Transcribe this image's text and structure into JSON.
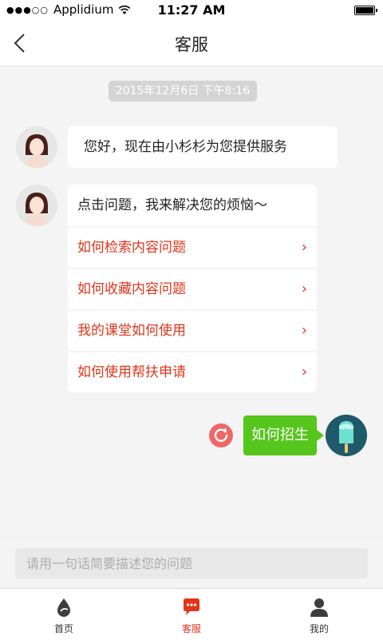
{
  "status_bar": {
    "signal": "●●●○○",
    "carrier": "Applidium",
    "time": "11:27 AM"
  },
  "nav": {
    "title": "客服"
  },
  "chat": {
    "timestamp": "2015年12月6日  下午8:16",
    "greeting": "您好，现在由小杉杉为您提供服务",
    "prompt": "点击问题，我来解决您的烦恼～",
    "questions": [
      {
        "label": "如何检索内容问题",
        "chevron": "›"
      },
      {
        "label": "如何收藏内容问题",
        "chevron": "›"
      },
      {
        "label": "我的课堂如何使用",
        "chevron": "›"
      },
      {
        "label": "如何使用帮扶申请",
        "chevron": "›"
      }
    ],
    "my_message": "如何招生"
  },
  "input": {
    "placeholder": "请用一句话简要描述您的问题",
    "value": ""
  },
  "tabs": [
    {
      "label": "首页",
      "icon": "home-drop-icon",
      "active": false
    },
    {
      "label": "客服",
      "icon": "chat-bubble-icon",
      "active": true
    },
    {
      "label": "我的",
      "icon": "person-icon",
      "active": false
    }
  ],
  "colors": {
    "accent": "#e2351a",
    "my_bubble": "#56c51c",
    "resend": "#f06767",
    "background": "#f4f4f4"
  }
}
